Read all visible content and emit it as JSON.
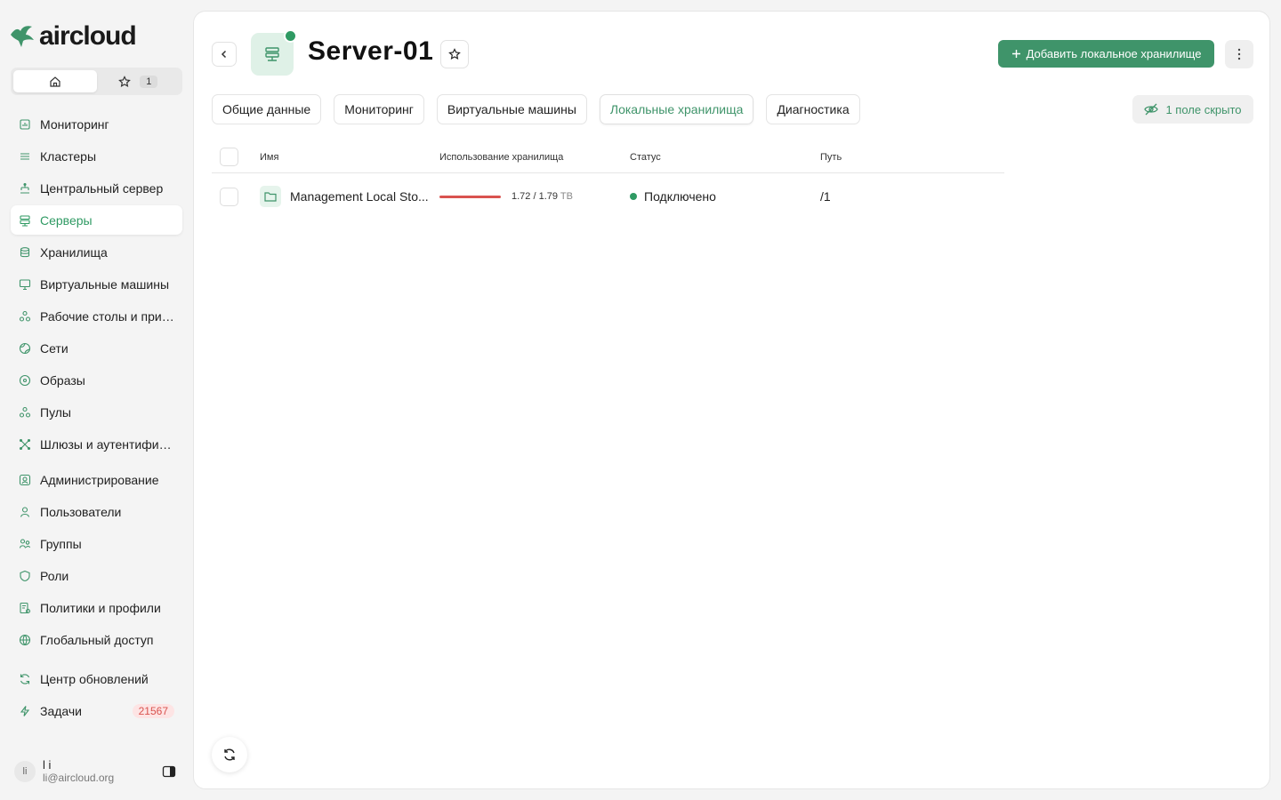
{
  "app": {
    "logo_text": "aircloud"
  },
  "switcher": {
    "favorites_count": "1"
  },
  "sidebar": {
    "items": [
      {
        "label": "Мониторинг",
        "icon": "chart-icon"
      },
      {
        "label": "Кластеры",
        "icon": "layers-icon"
      },
      {
        "label": "Центральный сервер",
        "icon": "network-icon"
      },
      {
        "label": "Серверы",
        "icon": "server-icon"
      },
      {
        "label": "Хранилища",
        "icon": "database-icon"
      },
      {
        "label": "Виртуальные машины",
        "icon": "monitor-icon"
      },
      {
        "label": "Рабочие столы и прил...",
        "icon": "apps-icon"
      },
      {
        "label": "Сети",
        "icon": "globe-grid-icon"
      },
      {
        "label": "Образы",
        "icon": "disc-icon"
      },
      {
        "label": "Пулы",
        "icon": "pools-icon"
      },
      {
        "label": "Шлюзы и аутентифика...",
        "icon": "gateway-icon"
      },
      {
        "label": "Администрирование",
        "icon": "admin-icon"
      },
      {
        "label": "Пользователи",
        "icon": "user-icon"
      },
      {
        "label": "Группы",
        "icon": "group-icon"
      },
      {
        "label": "Роли",
        "icon": "shield-icon"
      },
      {
        "label": "Политики и профили",
        "icon": "policy-icon"
      },
      {
        "label": "Глобальный доступ",
        "icon": "globe-icon"
      },
      {
        "label": "Центр обновлений",
        "icon": "refresh-icon"
      },
      {
        "label": "Задачи",
        "icon": "bolt-icon",
        "badge": "21567"
      }
    ],
    "active_index": 3
  },
  "user": {
    "initials": "li",
    "name": "l i",
    "email": "li@aircloud.org"
  },
  "header": {
    "title": "Server-01",
    "add_button_label": "Добавить локальное хранилище"
  },
  "tabs": [
    {
      "label": "Общие данные"
    },
    {
      "label": "Мониторинг"
    },
    {
      "label": "Виртуальные машины"
    },
    {
      "label": "Локальные хранилища",
      "active": true
    },
    {
      "label": "Диагностика"
    }
  ],
  "hidden_fields_label": "1 поле скрыто",
  "table": {
    "columns": [
      "Имя",
      "Использование хранилища",
      "Статус",
      "Путь"
    ],
    "rows": [
      {
        "name": "Management Local Sto...",
        "usage_value": "1.72 / 1.79",
        "usage_unit": "TB",
        "usage_fraction": 0.96,
        "status": "Подключено",
        "path": "/1"
      }
    ]
  },
  "colors": {
    "accent": "#3f946a",
    "status_connected": "#2f9a63",
    "usage_high": "#d9534f",
    "badge_bg": "#fde4e4"
  }
}
